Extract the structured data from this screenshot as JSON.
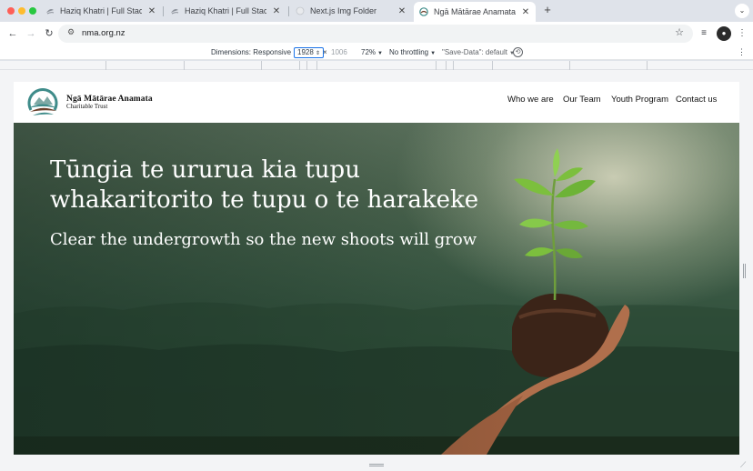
{
  "browser": {
    "tabs": [
      {
        "title": "Haziq Khatri | Full Stack Deve",
        "favicon": "harakeke-icon",
        "active": false
      },
      {
        "title": "Haziq Khatri | Full Stack Deve",
        "favicon": "harakeke-icon",
        "active": false
      },
      {
        "title": "Next.js Img Folder",
        "favicon": "globe-icon",
        "active": false
      },
      {
        "title": "Ngā Mātārae Anamata",
        "favicon": "nma-logo-icon",
        "active": true
      }
    ],
    "new_tab_glyph": "+",
    "close_glyph": "✕",
    "url": "nma.org.nz"
  },
  "devtools": {
    "dimensions_label": "Dimensions: Responsive",
    "width_value": "1928",
    "times_glyph": "×",
    "height_value": "1006",
    "zoom": "72%",
    "throttling": "No throttling",
    "save_data": "\"Save-Data\": default"
  },
  "site": {
    "brand_name": "Ngā Mātārae Anamata",
    "brand_sub": "Charitable Trust",
    "nav": [
      "Who we are",
      "Our Team",
      "Youth Program",
      "Contact us"
    ],
    "hero_title_line1": "Tūngia te ururua kia tupu",
    "hero_title_line2": "whakaritorito te tupu o te harakeke",
    "hero_subtitle": "Clear the undergrowth so the new shoots will grow"
  },
  "colors": {
    "tab_strip": "#dfe3ea",
    "accent_blue": "#1a73e8",
    "hero_green": "#2f4f3b",
    "logo_teal": "#3f8c8a",
    "logo_brown": "#6b3f2a"
  }
}
